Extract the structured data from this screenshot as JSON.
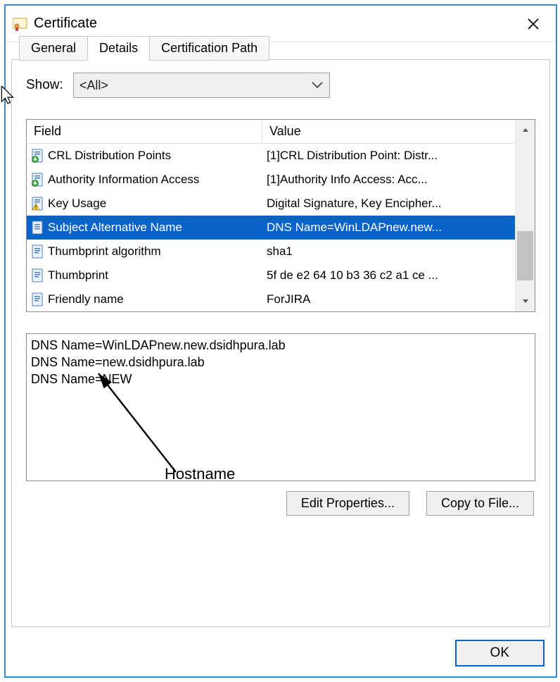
{
  "window": {
    "title": "Certificate"
  },
  "tabs": {
    "general": "General",
    "details": "Details",
    "certpath": "Certification Path"
  },
  "show": {
    "label": "Show:",
    "selected": "<All>"
  },
  "list": {
    "headers": {
      "field": "Field",
      "value": "Value"
    },
    "rows": [
      {
        "icon": "ext-dl",
        "field": "CRL Distribution Points",
        "value": "[1]CRL Distribution Point: Distr..."
      },
      {
        "icon": "ext-dl",
        "field": "Authority Information Access",
        "value": "[1]Authority Info Access: Acc..."
      },
      {
        "icon": "ext-warn",
        "field": "Key Usage",
        "value": "Digital Signature, Key Encipher..."
      },
      {
        "icon": "ext",
        "field": "Subject Alternative Name",
        "value": "DNS Name=WinLDAPnew.new...",
        "selected": true
      },
      {
        "icon": "prop",
        "field": "Thumbprint algorithm",
        "value": "sha1"
      },
      {
        "icon": "prop",
        "field": "Thumbprint",
        "value": "5f de e2 64 10 b3 36 c2 a1 ce ..."
      },
      {
        "icon": "prop",
        "field": "Friendly name",
        "value": "ForJIRA"
      }
    ]
  },
  "detail_text": "DNS Name=WinLDAPnew.new.dsidhpura.lab\nDNS Name=new.dsidhpura.lab\nDNS Name=NEW",
  "buttons": {
    "edit": "Edit Properties...",
    "copy": "Copy to File...",
    "ok": "OK"
  },
  "annotation": {
    "label": "Hostname"
  }
}
